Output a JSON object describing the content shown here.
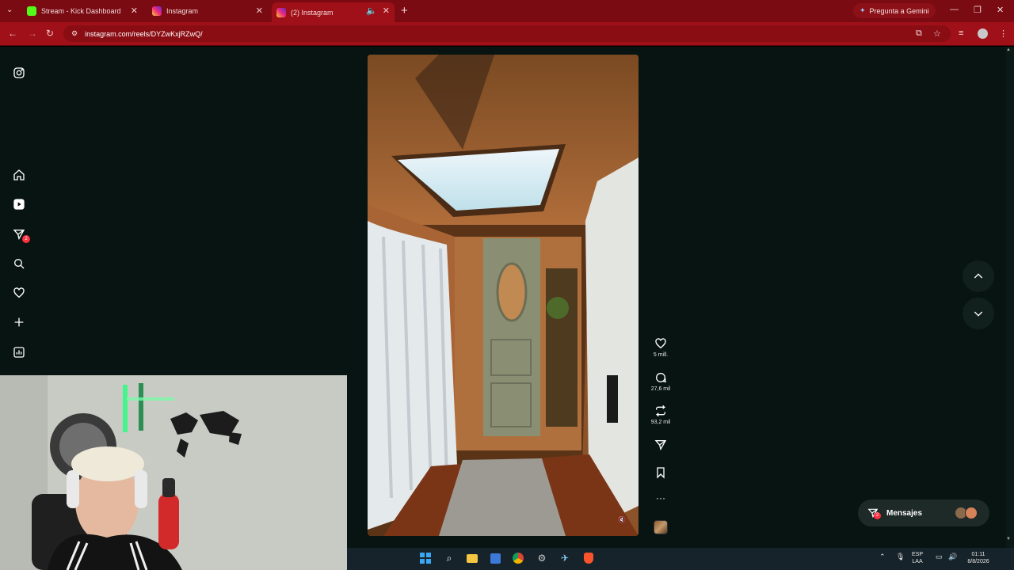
{
  "browser": {
    "tabs": [
      {
        "title": "Stream - Kick Dashboard",
        "favicon": "kick-icon",
        "active": false
      },
      {
        "title": "Instagram",
        "favicon": "instagram-icon",
        "active": false
      },
      {
        "title": "(2) Instagram",
        "favicon": "instagram-icon",
        "active": true
      }
    ],
    "gemini_button": "Pregunta a Gemini",
    "url": "instagram.com/reels/DYZwKxjRZwQ/",
    "accent_color": "#a01018"
  },
  "sidebar": {
    "items": [
      {
        "name": "instagram-logo-icon"
      },
      {
        "name": "home-icon"
      },
      {
        "name": "reels-icon"
      },
      {
        "name": "messages-icon",
        "badge": "2"
      },
      {
        "name": "search-icon"
      },
      {
        "name": "notifications-heart-icon"
      },
      {
        "name": "create-plus-icon"
      },
      {
        "name": "dashboard-icon"
      }
    ]
  },
  "reel": {
    "actions": {
      "likes": "5 mill.",
      "comments": "27,6 mil",
      "reposts": "93,2 mil"
    }
  },
  "messages_button": {
    "label": "Mensajes",
    "badge": "2"
  },
  "taskbar": {
    "lang_top": "ESP",
    "lang_bottom": "LAA",
    "time": "01:11",
    "date": "8/8/2026"
  }
}
